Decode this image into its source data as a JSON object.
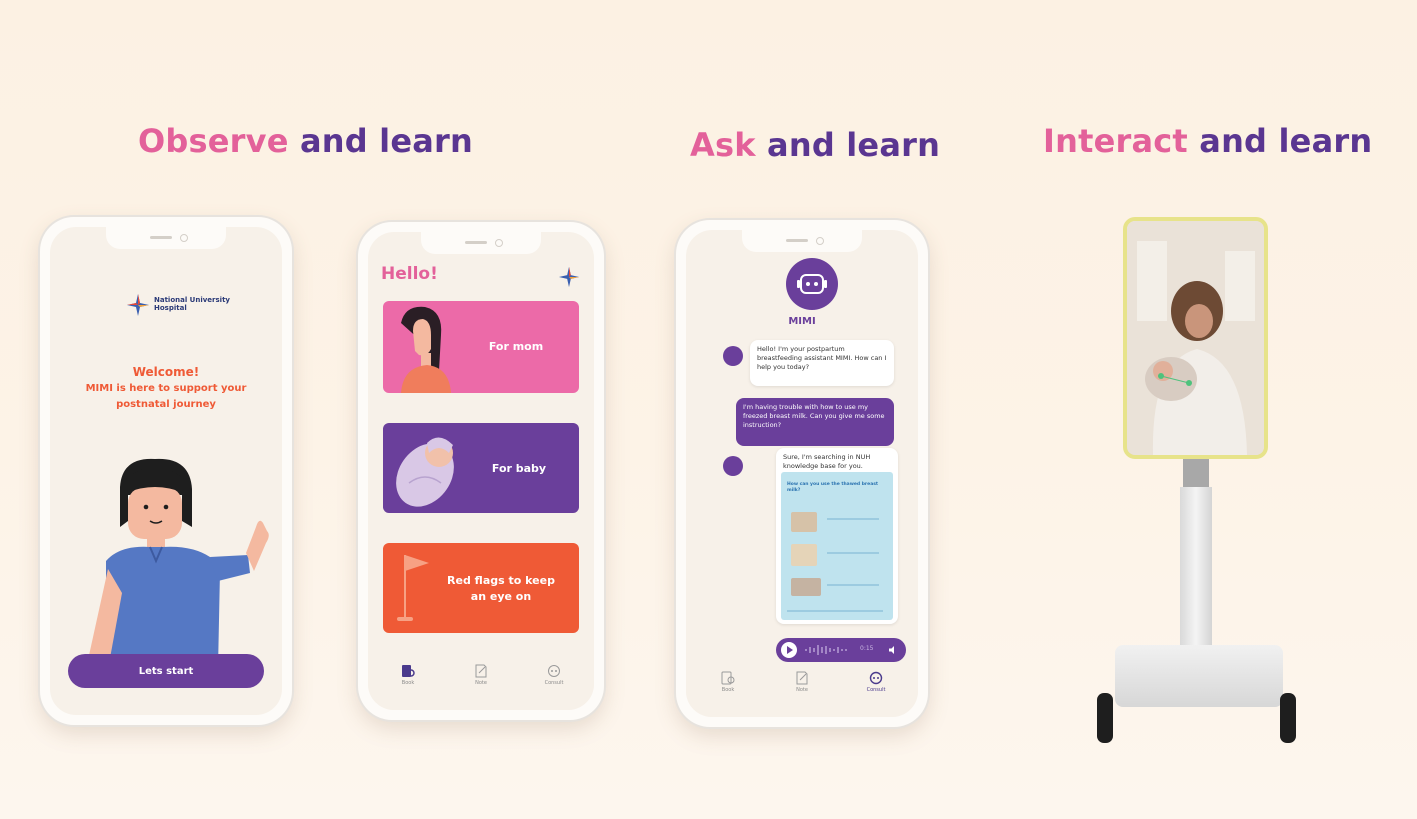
{
  "headlines": {
    "observe": {
      "accent": "Observe",
      "rest": " and learn"
    },
    "ask": {
      "accent": "Ask",
      "rest": " and learn"
    },
    "interact": {
      "accent": "Interact",
      "rest": " and learn"
    }
  },
  "phone1": {
    "hospital_name": "National University Hospital",
    "welcome_title": "Welcome!",
    "welcome_line1": "MIMI is here to support your",
    "welcome_line2": "postnatal journey",
    "start_button": "Lets start"
  },
  "phone2": {
    "greeting": "Hello!",
    "cards": [
      {
        "label": "For mom",
        "color": "#ec6aa8"
      },
      {
        "label": "For baby",
        "color": "#6a3f9b"
      },
      {
        "label_line1": "Red flags to keep",
        "label_line2": "an eye on",
        "color": "#ef5a36"
      }
    ],
    "tabs": [
      "Book",
      "Note",
      "Consult"
    ]
  },
  "phone3": {
    "bot_name": "MIMI",
    "messages": {
      "bot1": "Hello! I'm your postpartum breastfeeding assistant MIMI. How can I help you today?",
      "user1": "I'm having trouble with how to use my freezed breast milk. Can you give me some instruction?",
      "bot2": "Sure, I'm searching in NUH knowledge base for you.",
      "doc_title": "How can you use the thawed breast milk?"
    },
    "audio_time": "0:15",
    "tabs": [
      "Book",
      "Note",
      "Consult"
    ]
  },
  "colors": {
    "pink": "#e3619a",
    "purple": "#5a3691",
    "orange": "#ef5a36",
    "brand_purple": "#6a3f9b"
  }
}
